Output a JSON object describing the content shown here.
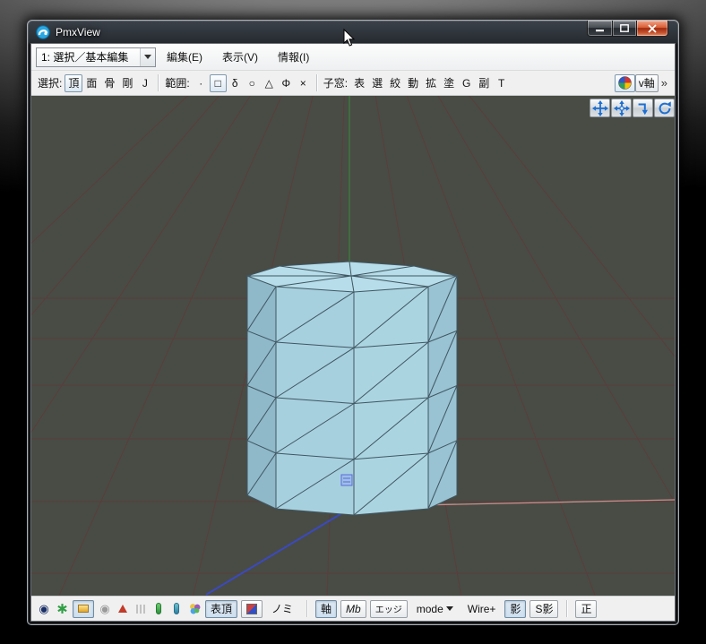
{
  "window": {
    "title": "PmxView"
  },
  "menubar": {
    "mode_combo": {
      "value": "1: 選択／基本編集"
    },
    "menus": [
      "編集(E)",
      "表示(V)",
      "情報(I)"
    ]
  },
  "toolbar": {
    "select": {
      "label": "選択:",
      "buttons": [
        "頂",
        "面",
        "骨",
        "剛",
        "J"
      ]
    },
    "range": {
      "label": "範囲:",
      "buttons": [
        "·",
        "□",
        "δ",
        "○",
        "△",
        "Φ",
        "×"
      ]
    },
    "subwin": {
      "label": "子窓:",
      "buttons": [
        "表",
        "選",
        "絞",
        "動",
        "拡",
        "塗",
        "G",
        "副",
        "T"
      ]
    },
    "vaxis_label": "v軸",
    "overflow_glyph": "»"
  },
  "viewport": {
    "icons": [
      "pan-icon",
      "pan-all-icon",
      "drop-arrow-icon",
      "orbit-icon"
    ]
  },
  "bottombar": {
    "icons": [
      "pivot-icon",
      "green-asterisk-icon",
      "floor-icon",
      "pivot-gray-icon",
      "red-triangle-icon",
      "hatch-icon",
      "green-pill-icon",
      "teal-pill-icon",
      "flower-icon",
      "material-icon"
    ],
    "labels": {
      "hyocho": "表頂",
      "nomi": "ノミ",
      "axis": "軸",
      "mb": "Mb",
      "edge": "エッジ",
      "mode": "mode",
      "mode_arrow": "▼",
      "wire": "Wire+",
      "shadow": "影",
      "self_shadow": "S影",
      "front": "正"
    }
  }
}
